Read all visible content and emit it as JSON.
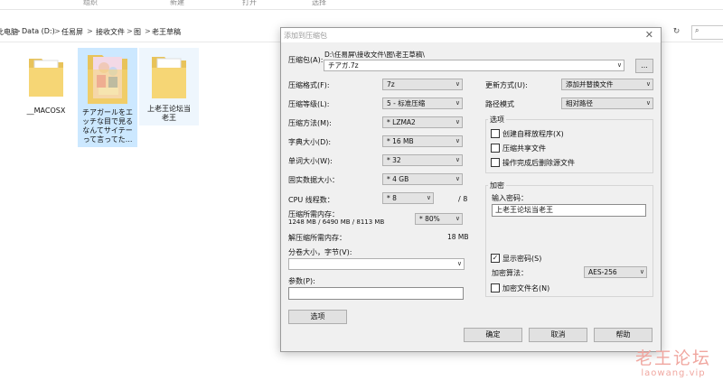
{
  "ribbon": {
    "labels": [
      "组织",
      "新建",
      "打开",
      "选择"
    ]
  },
  "address": {
    "crumbs": [
      "此电脑",
      "Data (D:)",
      "任易屏",
      "接收文件",
      "图",
      "老王草稿"
    ],
    "separator": ">",
    "refresh_icon": "refresh-icon",
    "search_icon": "search-icon"
  },
  "files": [
    {
      "name": "__MACOSX",
      "type": "folder"
    },
    {
      "name": "チアガールをエッチな目で見るなんてサイテーって言ってた...",
      "type": "folder-image",
      "selected": true
    },
    {
      "name": "上老王论坛当老王",
      "type": "folder"
    }
  ],
  "dialog": {
    "title": "添加到压缩包",
    "archive_label": "压缩包(A):",
    "archive_path": "D:\\任易屏\\接收文件\\图\\老王草稿\\",
    "archive_name": "チアガ.7z",
    "browse_button": "...",
    "left": {
      "format_label": "压缩格式(F):",
      "format_value": "7z",
      "level_label": "压缩等级(L):",
      "level_value": "5 - 标准压缩",
      "method_label": "压缩方法(M):",
      "method_value": "* LZMA2",
      "dict_label": "字典大小(D):",
      "dict_value": "* 16 MB",
      "word_label": "单词大小(W):",
      "word_value": "* 32",
      "solid_label": "固实数据大小：",
      "solid_value": "* 4 GB",
      "cpu_label": "CPU 线程数：",
      "cpu_value": "* 8",
      "cpu_total": "/ 8",
      "mem_label": "压缩所需内存：",
      "mem_detail": "1248 MB / 6490 MB / 8113 MB",
      "mem_value": "* 80%",
      "decomp_label": "解压缩所需内存：",
      "decomp_value": "18 MB",
      "split_label": "分卷大小，字节(V):",
      "split_value": "",
      "params_label": "参数(P):",
      "params_value": "",
      "options_button": "选项"
    },
    "right": {
      "update_label": "更新方式(U):",
      "update_value": "添加并替换文件",
      "path_label": "路径模式",
      "path_value": "相对路径",
      "options_group": "选项",
      "options": [
        {
          "label": "创建自释放程序(X)",
          "checked": false
        },
        {
          "label": "压缩共享文件",
          "checked": false
        },
        {
          "label": "操作完成后删除源文件",
          "checked": false
        }
      ],
      "encrypt_group": "加密",
      "password_label": "输入密码：",
      "password_value": "上老王论坛当老王",
      "show_password": {
        "label": "显示密码(S)",
        "checked": true
      },
      "encrypt_method_label": "加密算法：",
      "encrypt_method_value": "AES-256",
      "encrypt_names": {
        "label": "加密文件名(N)",
        "checked": false
      }
    },
    "buttons": {
      "ok": "确定",
      "cancel": "取消",
      "help": "帮助"
    }
  },
  "watermark": {
    "main": "老王论坛",
    "sub": "laowang.vip"
  },
  "colors": {
    "selection": "#cce8ff",
    "dialog_bg": "#f0f0f0",
    "watermark": "#f0a7a0"
  }
}
